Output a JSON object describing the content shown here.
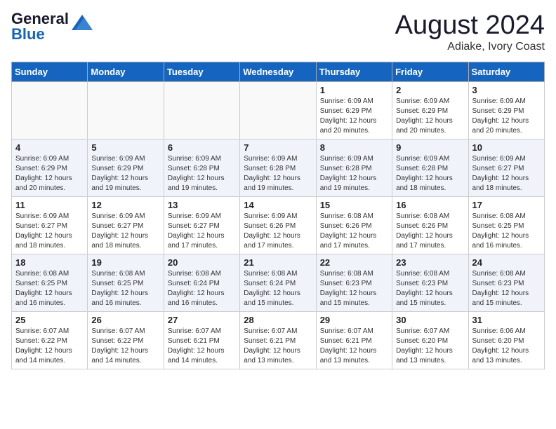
{
  "header": {
    "logo_general": "General",
    "logo_blue": "Blue",
    "month_year": "August 2024",
    "location": "Adiake, Ivory Coast"
  },
  "weekdays": [
    "Sunday",
    "Monday",
    "Tuesday",
    "Wednesday",
    "Thursday",
    "Friday",
    "Saturday"
  ],
  "weeks": [
    [
      {
        "day": "",
        "info": ""
      },
      {
        "day": "",
        "info": ""
      },
      {
        "day": "",
        "info": ""
      },
      {
        "day": "",
        "info": ""
      },
      {
        "day": "1",
        "info": "Sunrise: 6:09 AM\nSunset: 6:29 PM\nDaylight: 12 hours\nand 20 minutes."
      },
      {
        "day": "2",
        "info": "Sunrise: 6:09 AM\nSunset: 6:29 PM\nDaylight: 12 hours\nand 20 minutes."
      },
      {
        "day": "3",
        "info": "Sunrise: 6:09 AM\nSunset: 6:29 PM\nDaylight: 12 hours\nand 20 minutes."
      }
    ],
    [
      {
        "day": "4",
        "info": "Sunrise: 6:09 AM\nSunset: 6:29 PM\nDaylight: 12 hours\nand 20 minutes."
      },
      {
        "day": "5",
        "info": "Sunrise: 6:09 AM\nSunset: 6:29 PM\nDaylight: 12 hours\nand 19 minutes."
      },
      {
        "day": "6",
        "info": "Sunrise: 6:09 AM\nSunset: 6:28 PM\nDaylight: 12 hours\nand 19 minutes."
      },
      {
        "day": "7",
        "info": "Sunrise: 6:09 AM\nSunset: 6:28 PM\nDaylight: 12 hours\nand 19 minutes."
      },
      {
        "day": "8",
        "info": "Sunrise: 6:09 AM\nSunset: 6:28 PM\nDaylight: 12 hours\nand 19 minutes."
      },
      {
        "day": "9",
        "info": "Sunrise: 6:09 AM\nSunset: 6:28 PM\nDaylight: 12 hours\nand 18 minutes."
      },
      {
        "day": "10",
        "info": "Sunrise: 6:09 AM\nSunset: 6:27 PM\nDaylight: 12 hours\nand 18 minutes."
      }
    ],
    [
      {
        "day": "11",
        "info": "Sunrise: 6:09 AM\nSunset: 6:27 PM\nDaylight: 12 hours\nand 18 minutes."
      },
      {
        "day": "12",
        "info": "Sunrise: 6:09 AM\nSunset: 6:27 PM\nDaylight: 12 hours\nand 18 minutes."
      },
      {
        "day": "13",
        "info": "Sunrise: 6:09 AM\nSunset: 6:27 PM\nDaylight: 12 hours\nand 17 minutes."
      },
      {
        "day": "14",
        "info": "Sunrise: 6:09 AM\nSunset: 6:26 PM\nDaylight: 12 hours\nand 17 minutes."
      },
      {
        "day": "15",
        "info": "Sunrise: 6:08 AM\nSunset: 6:26 PM\nDaylight: 12 hours\nand 17 minutes."
      },
      {
        "day": "16",
        "info": "Sunrise: 6:08 AM\nSunset: 6:26 PM\nDaylight: 12 hours\nand 17 minutes."
      },
      {
        "day": "17",
        "info": "Sunrise: 6:08 AM\nSunset: 6:25 PM\nDaylight: 12 hours\nand 16 minutes."
      }
    ],
    [
      {
        "day": "18",
        "info": "Sunrise: 6:08 AM\nSunset: 6:25 PM\nDaylight: 12 hours\nand 16 minutes."
      },
      {
        "day": "19",
        "info": "Sunrise: 6:08 AM\nSunset: 6:25 PM\nDaylight: 12 hours\nand 16 minutes."
      },
      {
        "day": "20",
        "info": "Sunrise: 6:08 AM\nSunset: 6:24 PM\nDaylight: 12 hours\nand 16 minutes."
      },
      {
        "day": "21",
        "info": "Sunrise: 6:08 AM\nSunset: 6:24 PM\nDaylight: 12 hours\nand 15 minutes."
      },
      {
        "day": "22",
        "info": "Sunrise: 6:08 AM\nSunset: 6:23 PM\nDaylight: 12 hours\nand 15 minutes."
      },
      {
        "day": "23",
        "info": "Sunrise: 6:08 AM\nSunset: 6:23 PM\nDaylight: 12 hours\nand 15 minutes."
      },
      {
        "day": "24",
        "info": "Sunrise: 6:08 AM\nSunset: 6:23 PM\nDaylight: 12 hours\nand 15 minutes."
      }
    ],
    [
      {
        "day": "25",
        "info": "Sunrise: 6:07 AM\nSunset: 6:22 PM\nDaylight: 12 hours\nand 14 minutes."
      },
      {
        "day": "26",
        "info": "Sunrise: 6:07 AM\nSunset: 6:22 PM\nDaylight: 12 hours\nand 14 minutes."
      },
      {
        "day": "27",
        "info": "Sunrise: 6:07 AM\nSunset: 6:21 PM\nDaylight: 12 hours\nand 14 minutes."
      },
      {
        "day": "28",
        "info": "Sunrise: 6:07 AM\nSunset: 6:21 PM\nDaylight: 12 hours\nand 13 minutes."
      },
      {
        "day": "29",
        "info": "Sunrise: 6:07 AM\nSunset: 6:21 PM\nDaylight: 12 hours\nand 13 minutes."
      },
      {
        "day": "30",
        "info": "Sunrise: 6:07 AM\nSunset: 6:20 PM\nDaylight: 12 hours\nand 13 minutes."
      },
      {
        "day": "31",
        "info": "Sunrise: 6:06 AM\nSunset: 6:20 PM\nDaylight: 12 hours\nand 13 minutes."
      }
    ]
  ]
}
